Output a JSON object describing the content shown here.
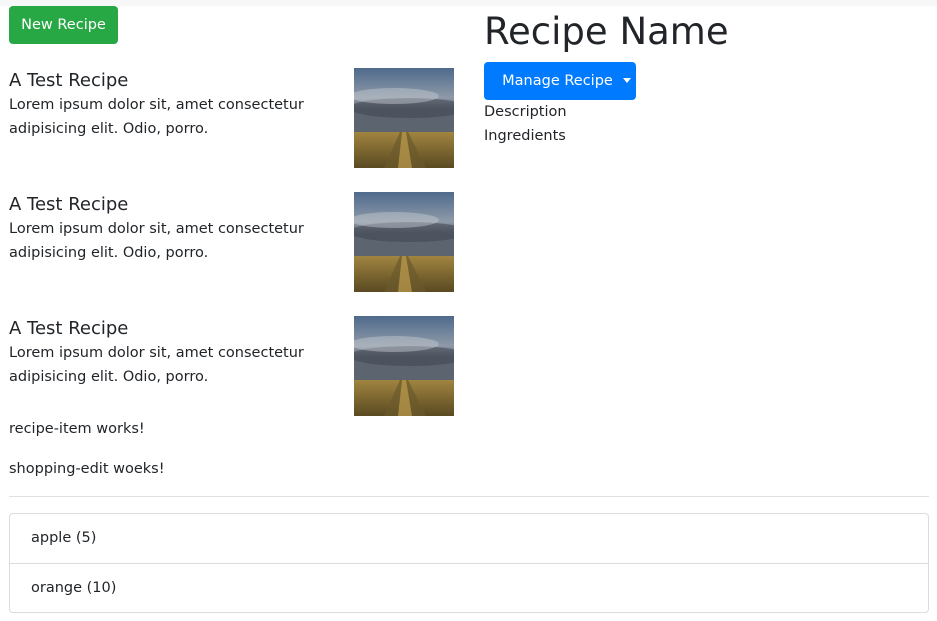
{
  "toolbar": {
    "new_recipe_label": "New Recipe"
  },
  "recipes": [
    {
      "name": "A Test Recipe",
      "description": "Lorem ipsum dolor sit, amet consectetur adipisicing elit. Odio, porro.",
      "image_alt": "landscape photo"
    },
    {
      "name": "A Test Recipe",
      "description": "Lorem ipsum dolor sit, amet consectetur adipisicing elit. Odio, porro.",
      "image_alt": "landscape photo"
    },
    {
      "name": "A Test Recipe",
      "description": "Lorem ipsum dolor sit, amet consectetur adipisicing elit. Odio, porro.",
      "image_alt": "landscape photo"
    }
  ],
  "notes": {
    "recipe_item": "recipe-item works!",
    "shopping_edit": "shopping-edit woeks!"
  },
  "shopping_list": [
    {
      "label": "apple (5)"
    },
    {
      "label": "orange (10)"
    }
  ],
  "detail": {
    "title": "Recipe Name",
    "manage_label": "Manage Recipe",
    "description_label": "Description",
    "ingredients_label": "Ingredients"
  },
  "colors": {
    "success": "#28a745",
    "primary": "#007bff",
    "text": "#212529",
    "border": "#dcdcdc"
  }
}
